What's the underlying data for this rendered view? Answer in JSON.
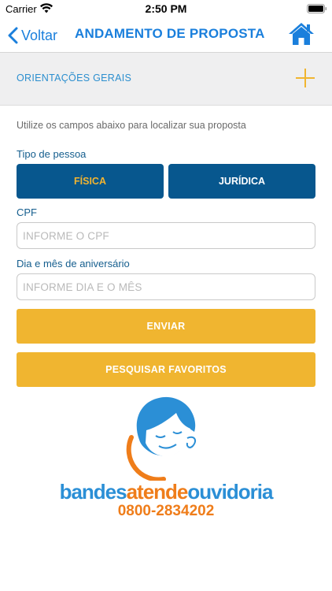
{
  "status_bar": {
    "carrier": "Carrier",
    "time": "2:50 PM"
  },
  "nav": {
    "back_label": "Voltar",
    "title": "ANDAMENTO DE PROPOSTA",
    "icons": {
      "back": "chevron-left-icon",
      "home": "home-icon"
    }
  },
  "accordion": {
    "label": "ORIENTAÇÕES GERAIS",
    "icon": "plus-icon"
  },
  "form": {
    "instructions": "Utilize os campos abaixo para localizar sua proposta",
    "person_type_label": "Tipo de pessoa",
    "person_types": [
      "FÍSICA",
      "JURÍDICA"
    ],
    "selected_person_type": "FÍSICA",
    "cpf_label": "CPF",
    "cpf_placeholder": "INFORME O CPF",
    "birthday_label": "Dia e mês de aniversário",
    "birthday_placeholder": "INFORME DIA E O MÊS",
    "submit_label": "ENVIAR",
    "favorites_label": "PESQUISAR FAVORITOS"
  },
  "footer_logo": {
    "brand_part1": "bandes",
    "brand_part2": "atende",
    "brand_part3": "ouvidoria",
    "phone": "0800-2834202"
  },
  "colors": {
    "accent_blue": "#1a7fdc",
    "button_blue": "#07578e",
    "button_yellow": "#f0b530",
    "brand_orange": "#ef7d1a",
    "brand_blue": "#2b8fd6"
  }
}
